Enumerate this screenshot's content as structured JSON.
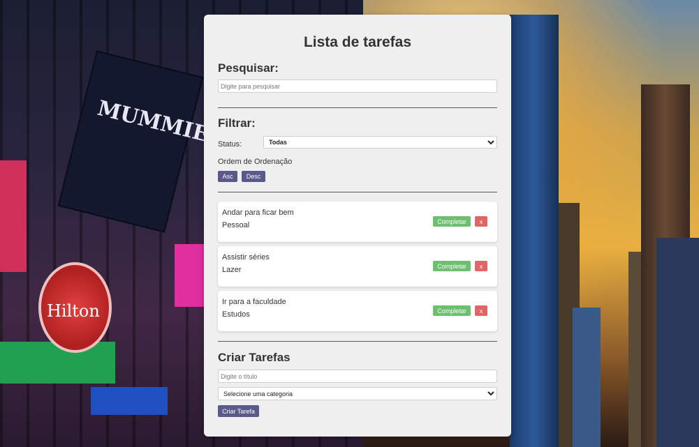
{
  "app": {
    "title": "Lista de tarefas"
  },
  "search": {
    "heading": "Pesquisar:",
    "placeholder": "Digite para pesquisar",
    "value": ""
  },
  "filter": {
    "heading": "Filtrar:",
    "status_label": "Status:",
    "status_selected": "Todas",
    "sort_label": "Ordem de Ordenação",
    "asc_label": "Asc",
    "desc_label": "Desc"
  },
  "tasks": [
    {
      "title": "Andar para ficar bem",
      "category": "Pessoal",
      "complete_label": "Completar",
      "delete_label": "x"
    },
    {
      "title": "Assistir séries",
      "category": "Lazer",
      "complete_label": "Completar",
      "delete_label": "x"
    },
    {
      "title": "Ir para a faculdade",
      "category": "Estudos",
      "complete_label": "Completar",
      "delete_label": "x"
    }
  ],
  "create": {
    "heading": "Criar Tarefas",
    "title_placeholder": "Digite o título",
    "category_selected": "Selecione uma categoria",
    "submit_label": "Criar Tarefa"
  },
  "background": {
    "signs": [
      "MUMMIES",
      "Hilton"
    ]
  },
  "colors": {
    "sort_button": "#5a5a8a",
    "complete_button": "#6cc070",
    "delete_button": "#e06666",
    "panel": "#efefef"
  }
}
